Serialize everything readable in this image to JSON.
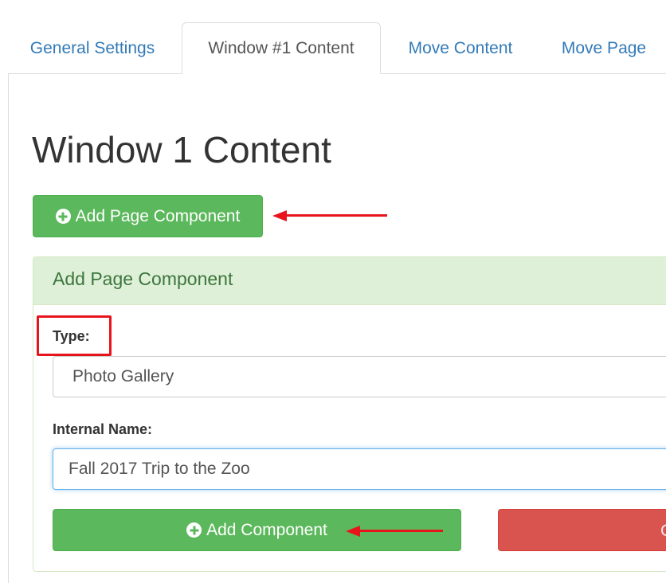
{
  "tabs": [
    {
      "label": "General Settings",
      "active": false
    },
    {
      "label": "Window #1 Content",
      "active": true
    },
    {
      "label": "Move Content",
      "active": false
    },
    {
      "label": "Move Page",
      "active": false
    }
  ],
  "main": {
    "title": "Window 1 Content",
    "add_page_component_button": "Add Page Component"
  },
  "panel": {
    "title": "Add Page Component",
    "type_label": "Type:",
    "type_value": "Photo Gallery",
    "internal_name_label": "Internal Name:",
    "internal_name_value": "Fall 2017 Trip to the Zoo",
    "add_component_button": "Add Component",
    "cancel_button_partial": "C"
  },
  "icons": {
    "add": "plus-circle-icon",
    "annotation": "red-arrow-icon"
  },
  "colors": {
    "link": "#337ab7",
    "success": "#5cb85c",
    "danger": "#d9534f",
    "panel_heading_bg": "#dff0d8",
    "panel_heading_text": "#3c763d",
    "annotation": "#e8141c",
    "focus_border": "#66afe9"
  }
}
